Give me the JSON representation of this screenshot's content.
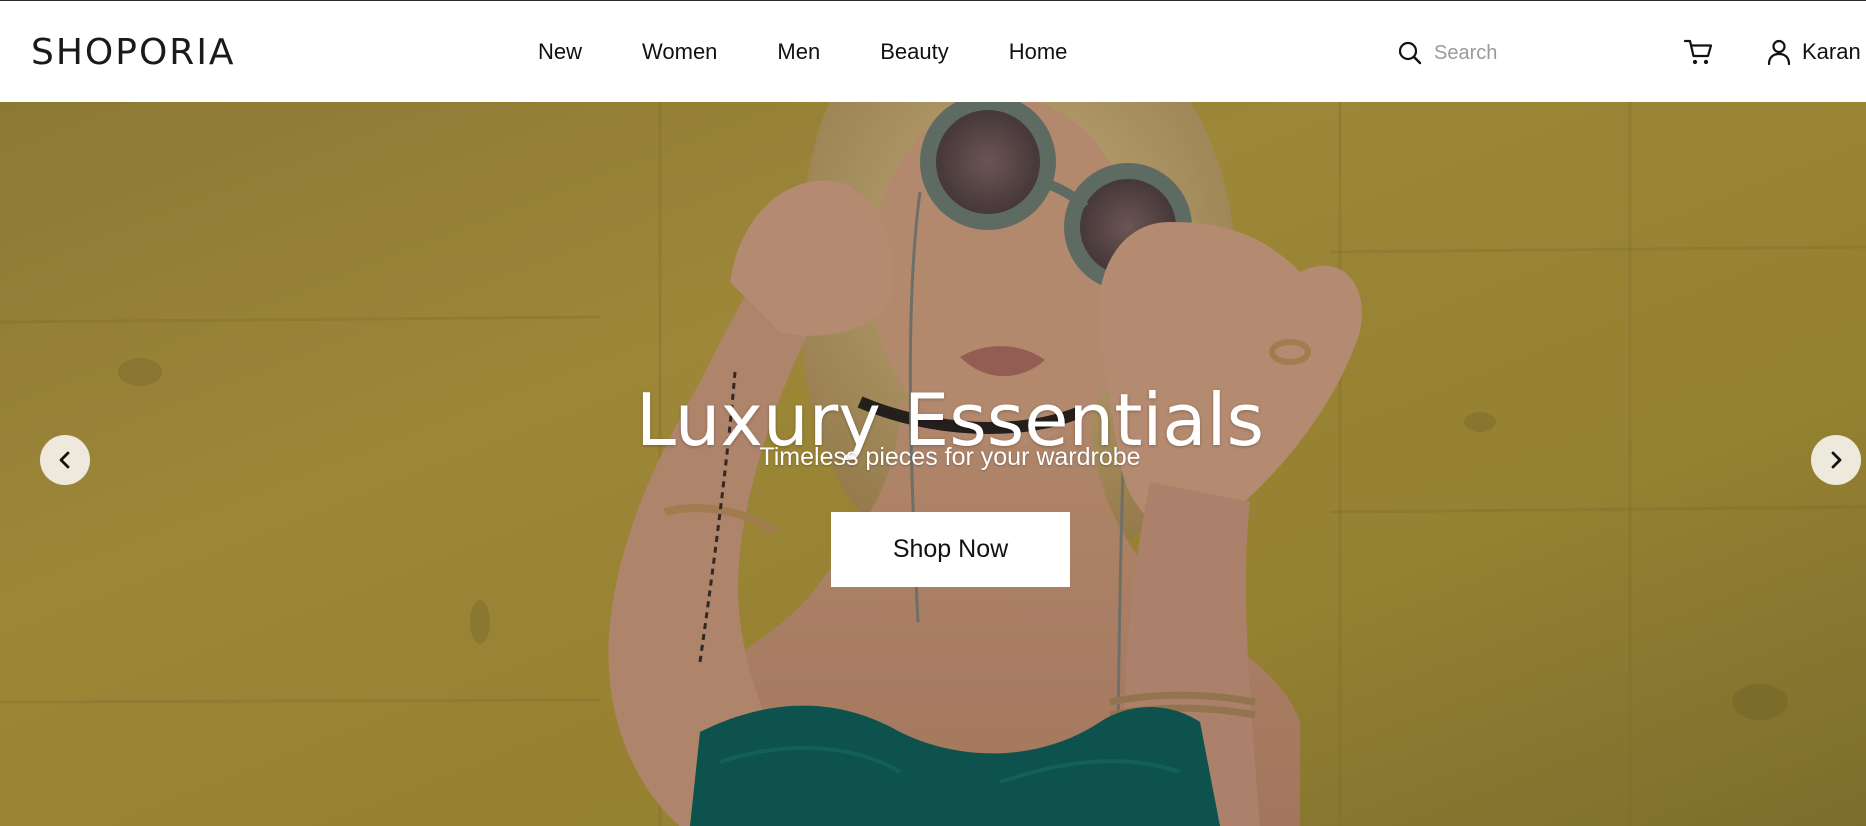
{
  "header": {
    "logo": "SHOPORIA",
    "nav": [
      {
        "label": "New"
      },
      {
        "label": "Women"
      },
      {
        "label": "Men"
      },
      {
        "label": "Beauty"
      },
      {
        "label": "Home"
      }
    ],
    "search": {
      "placeholder": "Search",
      "value": ""
    },
    "cart_icon": "cart-icon",
    "user": {
      "icon": "user-icon",
      "name": "Karan"
    }
  },
  "hero": {
    "title": "Luxury Essentials",
    "subtitle": "Timeless pieces for your wardrobe",
    "cta_label": "Shop Now",
    "prev_icon": "chevron-left-icon",
    "next_icon": "chevron-right-icon"
  },
  "colors": {
    "background": "#ffffff",
    "text": "#111111",
    "hero_wall": "#b49a3a",
    "hero_dress": "#0f5e57",
    "button_bg": "#ffffff"
  }
}
